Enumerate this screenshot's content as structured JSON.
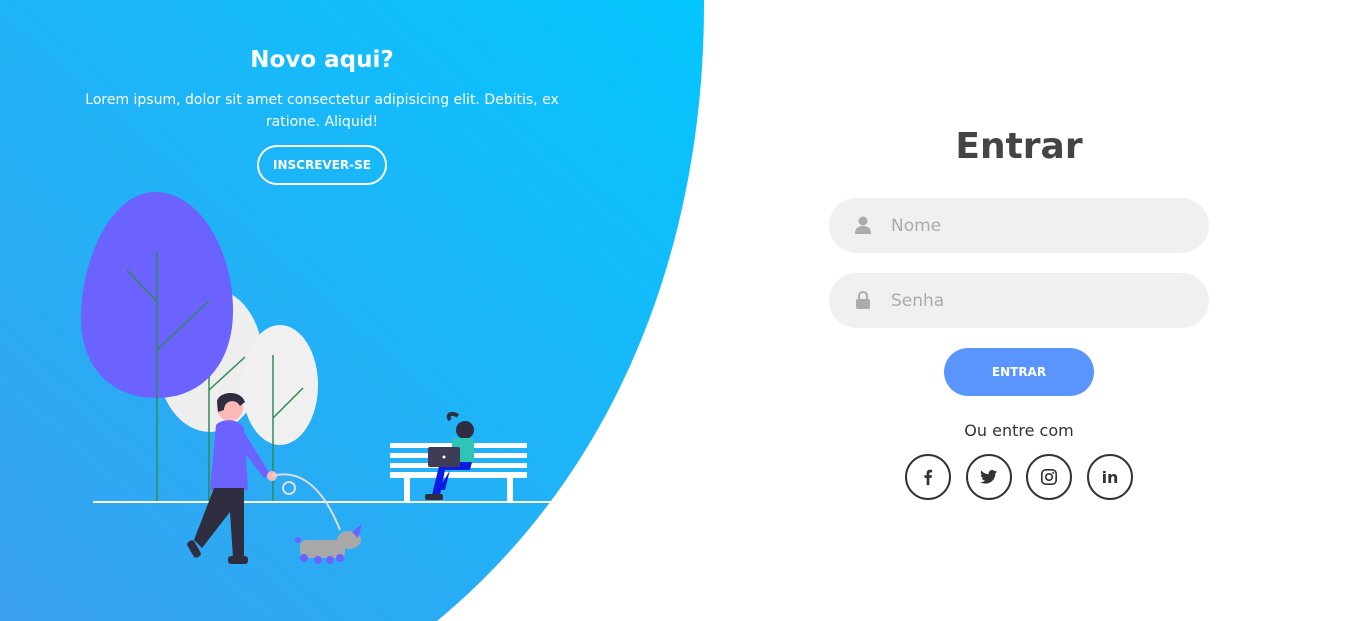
{
  "colors": {
    "gradient_start": "#4481eb",
    "gradient_end": "#04befe",
    "accent": "#5995fd",
    "field_bg": "#f0f0f0",
    "tree_purple": "#6c63ff"
  },
  "left_panel": {
    "title": "Novo aqui?",
    "description": "Lorem ipsum, dolor sit amet consectetur adipisicing elit. Debitis, ex ratione. Aliquid!",
    "signup_label": "INSCREVER-SE"
  },
  "form": {
    "title": "Entrar",
    "username": {
      "placeholder": "Nome",
      "value": "",
      "icon": "user-icon"
    },
    "password": {
      "placeholder": "Senha",
      "value": "",
      "icon": "lock-icon"
    },
    "submit_label": "ENTRAR",
    "social_text": "Ou entre com",
    "social": [
      {
        "name": "facebook",
        "icon": "facebook-icon"
      },
      {
        "name": "twitter",
        "icon": "twitter-icon"
      },
      {
        "name": "instagram",
        "icon": "instagram-icon"
      },
      {
        "name": "linkedin",
        "icon": "linkedin-icon",
        "glyph": "in"
      }
    ]
  }
}
